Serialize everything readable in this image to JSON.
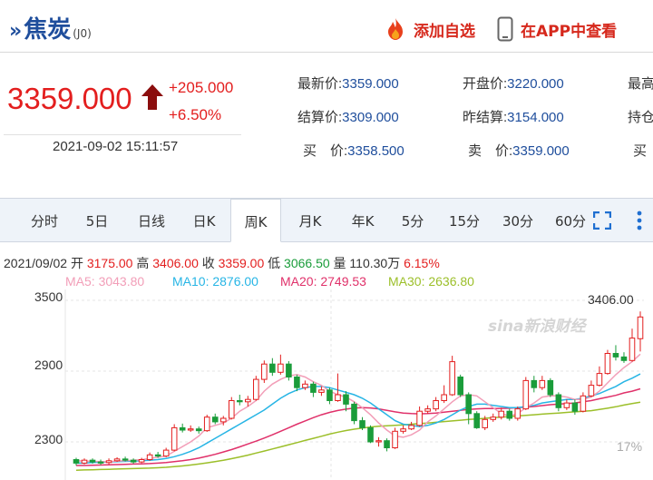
{
  "header": {
    "title": "焦炭",
    "code": "(J0)",
    "add_fav": "添加自选",
    "open_app": "在APP中查看"
  },
  "quote": {
    "price": "3359.000",
    "change": "+205.000",
    "change_pct": "+6.50%",
    "time": "2021-09-02 15:11:57",
    "fields": [
      {
        "label": "最新价:",
        "value": "3359.000"
      },
      {
        "label": "开盘价:",
        "value": "3220.000"
      },
      {
        "label": "最高",
        "value": ""
      },
      {
        "label": "结算价:",
        "value": "3309.000"
      },
      {
        "label": "昨结算:",
        "value": "3154.000"
      },
      {
        "label": "持仓",
        "value": ""
      },
      {
        "label": "买　价:",
        "value": "3358.500"
      },
      {
        "label": "卖　价:",
        "value": "3359.000"
      },
      {
        "label": "买",
        "value": ""
      }
    ]
  },
  "tabs": [
    "分时",
    "5日",
    "日线",
    "日K",
    "周K",
    "月K",
    "年K",
    "5分",
    "15分",
    "30分",
    "60分"
  ],
  "active_tab": "周K",
  "candle_info": {
    "date": "2021/09/02",
    "open_label": "开",
    "open": "3175.00",
    "high_label": "高",
    "high": "3406.00",
    "close_label": "收",
    "close": "3359.00",
    "low_label": "低",
    "low": "3066.50",
    "vol_label": "量",
    "vol": "110.30万",
    "pct": "6.15%"
  },
  "ma": {
    "ma5": "MA5: 3043.80",
    "ma10": "MA10: 2876.00",
    "ma20": "MA20: 2749.53",
    "ma30": "MA30: 2636.80"
  },
  "chart_axis": {
    "y_ticks": [
      "3500",
      "2900",
      "2300"
    ],
    "high_marker": "3406.00",
    "watermark": "sina新浪财经",
    "pct_marker": "17%"
  },
  "colors": {
    "up": "#e31e1e",
    "down": "#1a9c3a",
    "ma5": "#f29eb8",
    "ma10": "#27b5e5",
    "ma20": "#e0316a",
    "ma30": "#9cbf2a",
    "link": "#1f4e9c"
  },
  "chart_data": {
    "type": "candlestick",
    "ylim": [
      2130,
      3560
    ],
    "candles": [
      {
        "o": 2150,
        "c": 2120,
        "h": 2165,
        "l": 2100
      },
      {
        "o": 2120,
        "c": 2145,
        "h": 2160,
        "l": 2110
      },
      {
        "o": 2145,
        "c": 2130,
        "h": 2160,
        "l": 2115
      },
      {
        "o": 2130,
        "c": 2120,
        "h": 2150,
        "l": 2105
      },
      {
        "o": 2125,
        "c": 2140,
        "h": 2160,
        "l": 2110
      },
      {
        "o": 2140,
        "c": 2155,
        "h": 2170,
        "l": 2130
      },
      {
        "o": 2155,
        "c": 2145,
        "h": 2175,
        "l": 2135
      },
      {
        "o": 2145,
        "c": 2130,
        "h": 2160,
        "l": 2115
      },
      {
        "o": 2130,
        "c": 2150,
        "h": 2165,
        "l": 2120
      },
      {
        "o": 2150,
        "c": 2190,
        "h": 2210,
        "l": 2140
      },
      {
        "o": 2190,
        "c": 2180,
        "h": 2215,
        "l": 2165
      },
      {
        "o": 2180,
        "c": 2230,
        "h": 2250,
        "l": 2170
      },
      {
        "o": 2230,
        "c": 2420,
        "h": 2450,
        "l": 2220
      },
      {
        "o": 2420,
        "c": 2400,
        "h": 2455,
        "l": 2380
      },
      {
        "o": 2400,
        "c": 2410,
        "h": 2440,
        "l": 2385
      },
      {
        "o": 2410,
        "c": 2395,
        "h": 2430,
        "l": 2370
      },
      {
        "o": 2395,
        "c": 2510,
        "h": 2530,
        "l": 2385
      },
      {
        "o": 2510,
        "c": 2470,
        "h": 2540,
        "l": 2450
      },
      {
        "o": 2470,
        "c": 2500,
        "h": 2520,
        "l": 2440
      },
      {
        "o": 2500,
        "c": 2650,
        "h": 2680,
        "l": 2490
      },
      {
        "o": 2650,
        "c": 2640,
        "h": 2700,
        "l": 2610
      },
      {
        "o": 2640,
        "c": 2660,
        "h": 2690,
        "l": 2600
      },
      {
        "o": 2660,
        "c": 2830,
        "h": 2860,
        "l": 2650
      },
      {
        "o": 2830,
        "c": 2960,
        "h": 2990,
        "l": 2800
      },
      {
        "o": 2960,
        "c": 2890,
        "h": 3010,
        "l": 2860
      },
      {
        "o": 2890,
        "c": 2960,
        "h": 3040,
        "l": 2870
      },
      {
        "o": 2960,
        "c": 2850,
        "h": 2985,
        "l": 2820
      },
      {
        "o": 2850,
        "c": 2760,
        "h": 2870,
        "l": 2730
      },
      {
        "o": 2760,
        "c": 2790,
        "h": 2820,
        "l": 2740
      },
      {
        "o": 2790,
        "c": 2720,
        "h": 2810,
        "l": 2680
      },
      {
        "o": 2720,
        "c": 2740,
        "h": 2770,
        "l": 2690
      },
      {
        "o": 2740,
        "c": 2650,
        "h": 2760,
        "l": 2620
      },
      {
        "o": 2650,
        "c": 2700,
        "h": 2880,
        "l": 2640
      },
      {
        "o": 2700,
        "c": 2620,
        "h": 2730,
        "l": 2560
      },
      {
        "o": 2620,
        "c": 2480,
        "h": 2640,
        "l": 2450
      },
      {
        "o": 2480,
        "c": 2420,
        "h": 2510,
        "l": 2400
      },
      {
        "o": 2420,
        "c": 2300,
        "h": 2440,
        "l": 2290
      },
      {
        "o": 2300,
        "c": 2310,
        "h": 2340,
        "l": 2260
      },
      {
        "o": 2310,
        "c": 2250,
        "h": 2330,
        "l": 2220
      },
      {
        "o": 2250,
        "c": 2390,
        "h": 2420,
        "l": 2240
      },
      {
        "o": 2390,
        "c": 2410,
        "h": 2440,
        "l": 2370
      },
      {
        "o": 2410,
        "c": 2440,
        "h": 2470,
        "l": 2400
      },
      {
        "o": 2440,
        "c": 2560,
        "h": 2600,
        "l": 2430
      },
      {
        "o": 2560,
        "c": 2580,
        "h": 2610,
        "l": 2540
      },
      {
        "o": 2580,
        "c": 2650,
        "h": 2680,
        "l": 2560
      },
      {
        "o": 2650,
        "c": 2700,
        "h": 2780,
        "l": 2630
      },
      {
        "o": 2700,
        "c": 2980,
        "h": 3030,
        "l": 2690
      },
      {
        "o": 2850,
        "c": 2700,
        "h": 2870,
        "l": 2680
      },
      {
        "o": 2700,
        "c": 2540,
        "h": 2720,
        "l": 2450
      },
      {
        "o": 2540,
        "c": 2420,
        "h": 2560,
        "l": 2410
      },
      {
        "o": 2420,
        "c": 2490,
        "h": 2520,
        "l": 2400
      },
      {
        "o": 2490,
        "c": 2510,
        "h": 2540,
        "l": 2470
      },
      {
        "o": 2510,
        "c": 2560,
        "h": 2590,
        "l": 2490
      },
      {
        "o": 2560,
        "c": 2500,
        "h": 2580,
        "l": 2480
      },
      {
        "o": 2500,
        "c": 2580,
        "h": 2600,
        "l": 2480
      },
      {
        "o": 2580,
        "c": 2820,
        "h": 2850,
        "l": 2570
      },
      {
        "o": 2820,
        "c": 2760,
        "h": 2860,
        "l": 2720
      },
      {
        "o": 2760,
        "c": 2820,
        "h": 2860,
        "l": 2740
      },
      {
        "o": 2820,
        "c": 2700,
        "h": 2840,
        "l": 2680
      },
      {
        "o": 2700,
        "c": 2590,
        "h": 2720,
        "l": 2560
      },
      {
        "o": 2590,
        "c": 2630,
        "h": 2660,
        "l": 2570
      },
      {
        "o": 2630,
        "c": 2560,
        "h": 2660,
        "l": 2530
      },
      {
        "o": 2560,
        "c": 2690,
        "h": 2720,
        "l": 2550
      },
      {
        "o": 2690,
        "c": 2780,
        "h": 2820,
        "l": 2680
      },
      {
        "o": 2780,
        "c": 2880,
        "h": 2940,
        "l": 2770
      },
      {
        "o": 2880,
        "c": 3050,
        "h": 3080,
        "l": 2870
      },
      {
        "o": 3050,
        "c": 3020,
        "h": 3120,
        "l": 2990
      },
      {
        "o": 3020,
        "c": 2990,
        "h": 3060,
        "l": 2970
      },
      {
        "o": 2990,
        "c": 3180,
        "h": 3260,
        "l": 2980
      },
      {
        "o": 3175,
        "c": 3359,
        "h": 3406,
        "l": 3066
      }
    ],
    "ma5": [
      2140,
      2138,
      2135,
      2133,
      2131,
      2138,
      2140,
      2145,
      2150,
      2160,
      2170,
      2180,
      2220,
      2260,
      2300,
      2350,
      2420,
      2440,
      2460,
      2500,
      2560,
      2600,
      2650,
      2730,
      2790,
      2830,
      2860,
      2870,
      2850,
      2810,
      2780,
      2730,
      2700,
      2680,
      2640,
      2590,
      2530,
      2460,
      2400,
      2350,
      2340,
      2360,
      2400,
      2470,
      2520,
      2580,
      2640,
      2690,
      2700,
      2690,
      2640,
      2590,
      2540,
      2520,
      2540,
      2590,
      2630,
      2680,
      2690,
      2690,
      2680,
      2660,
      2660,
      2680,
      2730,
      2800,
      2870,
      2930,
      2980,
      3044
    ],
    "ma10": [
      2120,
      2120,
      2125,
      2128,
      2130,
      2132,
      2135,
      2138,
      2140,
      2145,
      2150,
      2160,
      2175,
      2195,
      2220,
      2250,
      2290,
      2330,
      2370,
      2410,
      2450,
      2490,
      2530,
      2570,
      2620,
      2670,
      2710,
      2740,
      2760,
      2770,
      2770,
      2760,
      2740,
      2720,
      2700,
      2670,
      2630,
      2580,
      2530,
      2480,
      2450,
      2440,
      2430,
      2440,
      2460,
      2490,
      2530,
      2570,
      2600,
      2620,
      2620,
      2610,
      2600,
      2590,
      2590,
      2600,
      2610,
      2630,
      2640,
      2650,
      2660,
      2660,
      2670,
      2690,
      2710,
      2740,
      2770,
      2810,
      2840,
      2876
    ],
    "ma20": [
      2100,
      2100,
      2102,
      2104,
      2106,
      2108,
      2110,
      2112,
      2114,
      2116,
      2120,
      2125,
      2132,
      2140,
      2150,
      2162,
      2178,
      2195,
      2215,
      2235,
      2258,
      2282,
      2306,
      2332,
      2360,
      2390,
      2420,
      2450,
      2478,
      2505,
      2530,
      2550,
      2566,
      2578,
      2586,
      2590,
      2588,
      2580,
      2568,
      2555,
      2545,
      2540,
      2538,
      2540,
      2545,
      2552,
      2560,
      2568,
      2575,
      2580,
      2582,
      2583,
      2584,
      2585,
      2590,
      2595,
      2600,
      2608,
      2615,
      2620,
      2625,
      2630,
      2640,
      2650,
      2665,
      2680,
      2695,
      2715,
      2730,
      2750
    ],
    "ma30": [
      2060,
      2062,
      2064,
      2066,
      2068,
      2070,
      2072,
      2074,
      2076,
      2078,
      2081,
      2085,
      2090,
      2096,
      2104,
      2112,
      2122,
      2133,
      2145,
      2158,
      2172,
      2188,
      2205,
      2222,
      2240,
      2258,
      2276,
      2294,
      2312,
      2330,
      2348,
      2366,
      2382,
      2396,
      2408,
      2418,
      2426,
      2432,
      2436,
      2440,
      2445,
      2450,
      2455,
      2460,
      2466,
      2472,
      2478,
      2484,
      2490,
      2495,
      2500,
      2505,
      2510,
      2515,
      2520,
      2525,
      2530,
      2535,
      2540,
      2545,
      2550,
      2555,
      2560,
      2565,
      2575,
      2585,
      2598,
      2612,
      2625,
      2637
    ]
  }
}
